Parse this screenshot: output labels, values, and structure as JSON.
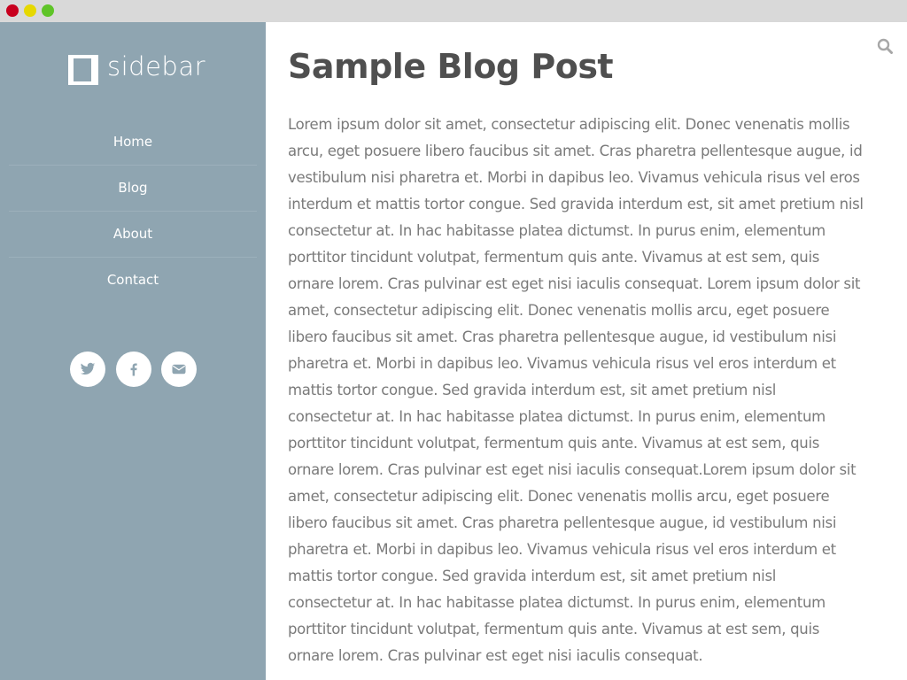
{
  "window": {
    "controls": [
      "close",
      "minimize",
      "maximize"
    ]
  },
  "sidebar": {
    "logo_text": "sidebar",
    "nav": [
      {
        "label": "Home"
      },
      {
        "label": "Blog"
      },
      {
        "label": "About"
      },
      {
        "label": "Contact"
      }
    ],
    "social": [
      {
        "icon": "twitter-icon",
        "glyph": "t"
      },
      {
        "icon": "facebook-icon",
        "glyph": "f"
      },
      {
        "icon": "email-icon",
        "glyph": ""
      }
    ],
    "background_color": "#8fa5b1"
  },
  "main": {
    "search_icon": "search-icon",
    "title": "Sample Blog Post",
    "body": "Lorem ipsum dolor sit amet, consectetur adipiscing elit. Donec venenatis mollis arcu, eget posuere libero faucibus sit amet. Cras pharetra pellentesque augue, id vestibulum nisi pharetra et. Morbi in dapibus leo. Vivamus vehicula risus vel eros interdum et mattis tortor congue. Sed gravida interdum est, sit amet pretium nisl consectetur at. In hac habitasse platea dictumst. In purus enim, elementum porttitor tincidunt volutpat, fermentum quis ante. Vivamus at est sem, quis ornare lorem. Cras pulvinar est eget nisi iaculis consequat. Lorem ipsum dolor sit amet, consectetur adipiscing elit. Donec venenatis mollis arcu, eget posuere libero faucibus sit amet. Cras pharetra pellentesque augue, id vestibulum nisi pharetra et. Morbi in dapibus leo. Vivamus vehicula risus vel eros interdum et mattis tortor congue. Sed gravida interdum est, sit amet pretium nisl consectetur at. In hac habitasse platea dictumst. In purus enim, elementum porttitor tincidunt volutpat, fermentum quis ante. Vivamus at est sem, quis ornare lorem. Cras pulvinar est eget nisi iaculis consequat.Lorem ipsum dolor sit amet, consectetur adipiscing elit. Donec venenatis mollis arcu, eget posuere libero faucibus sit amet. Cras pharetra pellentesque augue, id vestibulum nisi pharetra et. Morbi in dapibus leo. Vivamus vehicula risus vel eros interdum et mattis tortor congue. Sed gravida interdum est, sit amet pretium nisl consectetur at. In hac habitasse platea dictumst. In purus enim, elementum porttitor tincidunt volutpat, fermentum quis ante. Vivamus at est sem, quis ornare lorem. Cras pulvinar est eget nisi iaculis consequat."
  }
}
